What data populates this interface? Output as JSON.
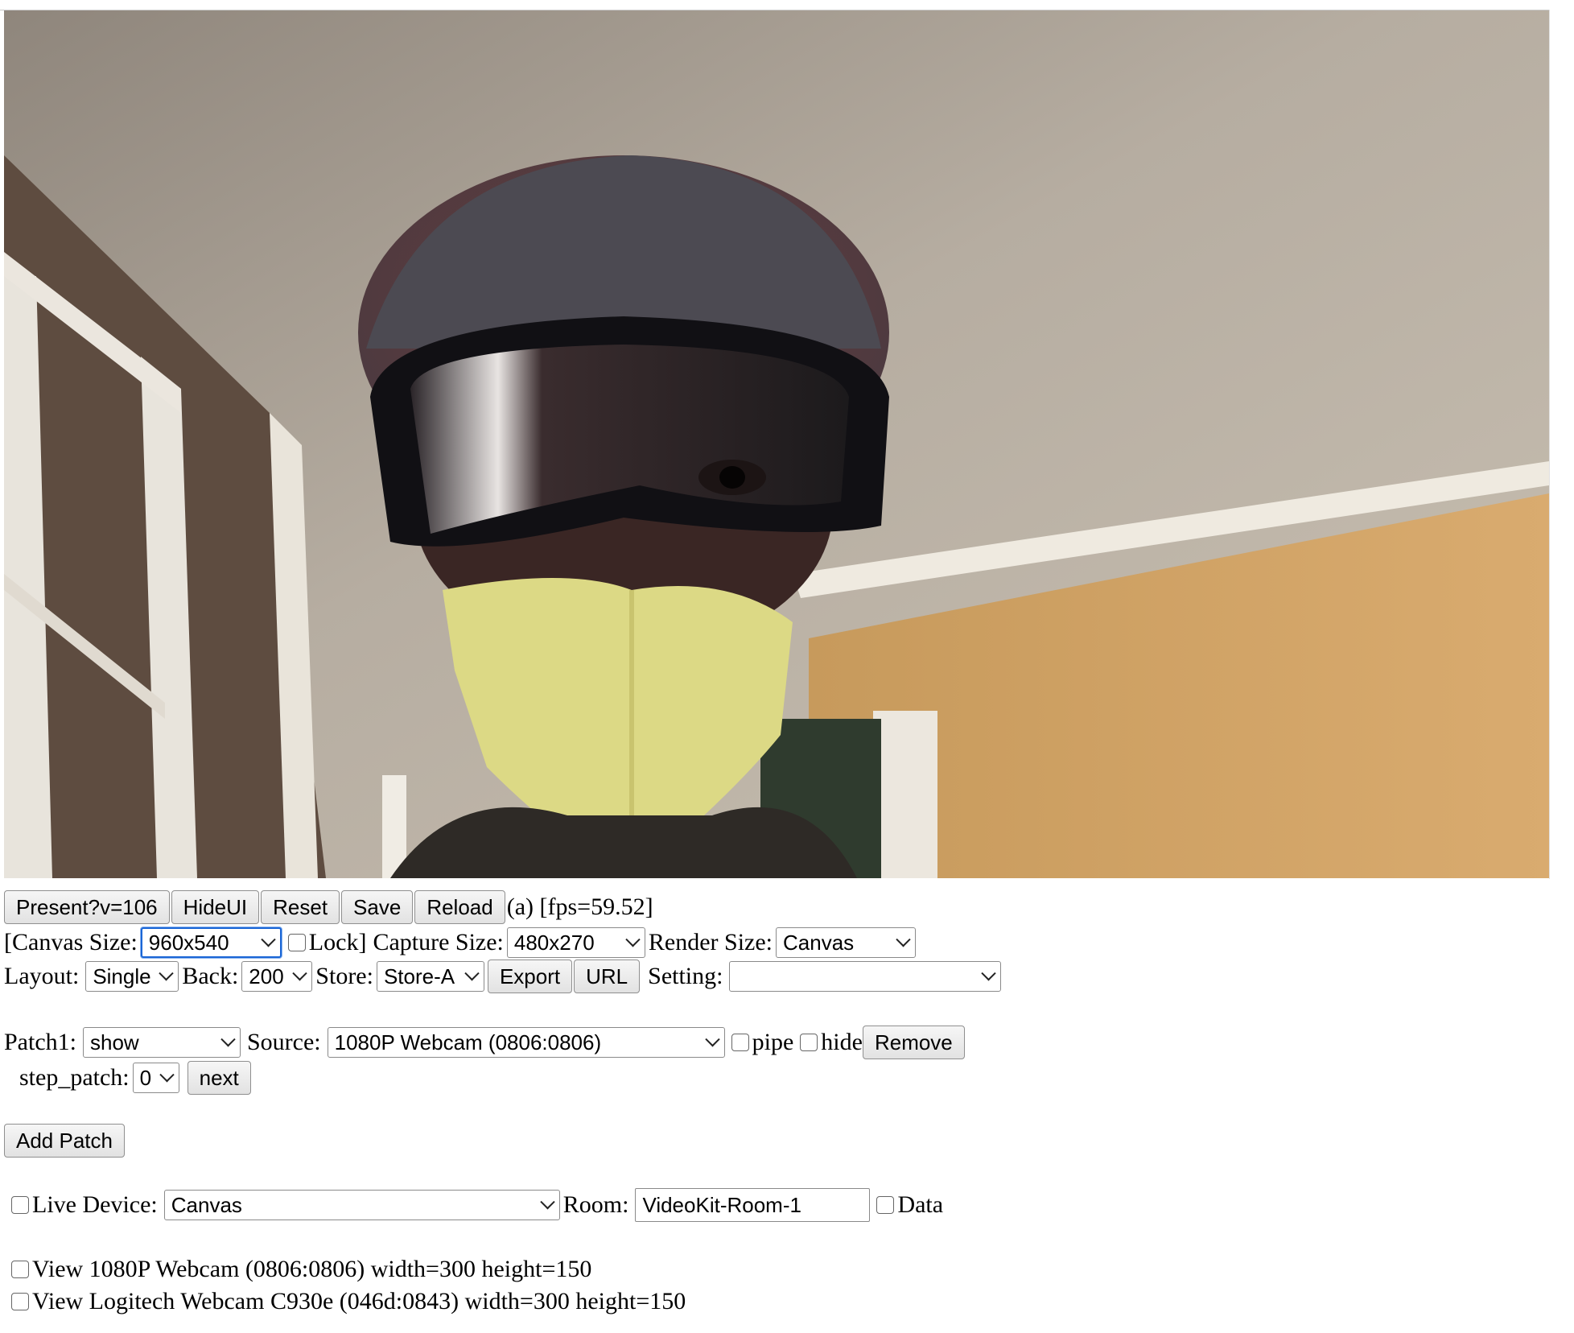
{
  "toolbar": {
    "present_label": "Present?v=106",
    "hideui_label": "HideUI",
    "reset_label": "Reset",
    "save_label": "Save",
    "reload_label": "Reload",
    "fps_text": "(a) [fps=59.52]"
  },
  "sizes": {
    "canvas_size_label": "[Canvas Size:",
    "canvas_size_value": "960x540",
    "lock_label": "Lock]",
    "lock_checked": false,
    "capture_size_label": "Capture Size:",
    "capture_size_value": "480x270",
    "render_size_label": "Render Size:",
    "render_size_value": "Canvas"
  },
  "layout_row": {
    "layout_label": "Layout:",
    "layout_value": "Single",
    "back_label": "Back:",
    "back_value": "200",
    "store_label": "Store:",
    "store_value": "Store-A",
    "export_label": "Export",
    "url_label": "URL",
    "setting_label": "Setting:",
    "setting_value": ""
  },
  "patch1": {
    "patch_label": "Patch1:",
    "patch_value": "show",
    "source_label": "Source:",
    "source_value": "1080P Webcam (0806:0806)",
    "pipe_label": "pipe",
    "hide_label": "hide",
    "remove_label": "Remove",
    "step_patch_label": "step_patch:",
    "step_patch_value": "0",
    "next_label": "next"
  },
  "add_patch_label": "Add Patch",
  "live": {
    "live_device_label": "Live Device:",
    "live_device_value": "Canvas",
    "room_label": "Room:",
    "room_value": "VideoKit-Room-1",
    "data_label": "Data"
  },
  "views": [
    {
      "label": "View 1080P Webcam (0806:0806) width=300 height=150",
      "checked": false
    },
    {
      "label": "View Logitech Webcam C930e (046d:0843) width=300 height=150",
      "checked": false
    }
  ],
  "video": {
    "subject": "person wearing dark ski goggles, yellow KN95 mask and dark cap",
    "wall_color": "#d9a86a",
    "ceiling_color": "#b7aea2",
    "mask_color": "#dcd985"
  }
}
